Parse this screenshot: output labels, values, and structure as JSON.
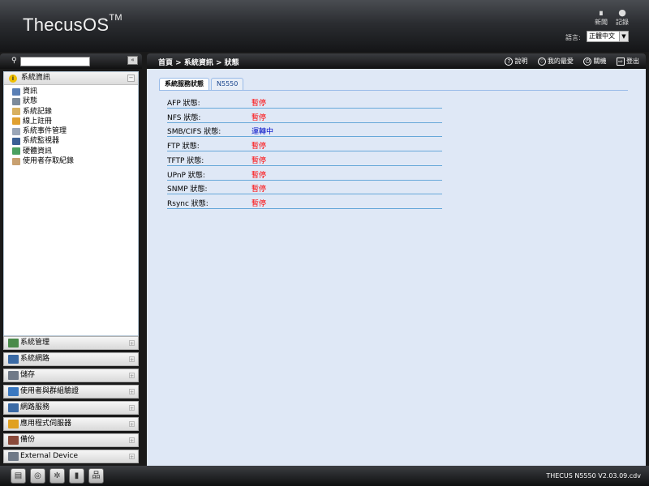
{
  "header": {
    "logo_text": "ThecusOS",
    "logo_tm": "TM",
    "news_label": "新聞",
    "log_label": "記錄",
    "language_label": "語言:",
    "language_value": "正體中文"
  },
  "sidebar": {
    "search_placeholder": "",
    "collapse_label": "«",
    "panel_title": "系統資訊",
    "items": [
      {
        "label": "資訊",
        "icon": "info-monitor-icon",
        "color": "#5a7fb5"
      },
      {
        "label": "狀態",
        "icon": "status-user-icon",
        "color": "#7c8a9a"
      },
      {
        "label": "系統記錄",
        "icon": "log-icon",
        "color": "#d8b060"
      },
      {
        "label": "線上註冊",
        "icon": "register-icon",
        "color": "#e0a030"
      },
      {
        "label": "系統事件管理",
        "icon": "event-icon",
        "color": "#9aa6b8"
      },
      {
        "label": "系統監視器",
        "icon": "monitor-icon",
        "color": "#3a5f95"
      },
      {
        "label": "硬體資訊",
        "icon": "hardware-icon",
        "color": "#4aa060"
      },
      {
        "label": "使用者存取紀錄",
        "icon": "access-log-icon",
        "color": "#c8a070"
      }
    ],
    "sections": [
      {
        "label": "系統管理",
        "icon": "tools-icon",
        "color": "#4a8a4a"
      },
      {
        "label": "系統網路",
        "icon": "network-icon",
        "color": "#3a6aa5"
      },
      {
        "label": "儲存",
        "icon": "storage-icon",
        "color": "#707a88"
      },
      {
        "label": "使用者與群組驗證",
        "icon": "users-icon",
        "color": "#3a78c0"
      },
      {
        "label": "網路服務",
        "icon": "network-service-icon",
        "color": "#3a6aa5"
      },
      {
        "label": "應用程式伺服器",
        "icon": "app-server-icon",
        "color": "#e0a020"
      },
      {
        "label": "備份",
        "icon": "backup-icon",
        "color": "#8a4a3a"
      },
      {
        "label": "External Device",
        "icon": "external-device-icon",
        "color": "#707a88"
      }
    ]
  },
  "main": {
    "breadcrumb": {
      "home": "首頁",
      "sep1": " > ",
      "level1": "系統資訊",
      "sep2": " > ",
      "level2": "狀態"
    },
    "toolbar": {
      "help": "說明",
      "favorites": "我的最愛",
      "shutdown": "關機",
      "logout": "登出"
    },
    "tabs": [
      {
        "label": "系統服務狀態",
        "active": true
      },
      {
        "label": "N5550",
        "active": false
      }
    ],
    "services": [
      {
        "label": "AFP 狀態:",
        "value": "暫停",
        "status": "stop"
      },
      {
        "label": "NFS 狀態:",
        "value": "暫停",
        "status": "stop"
      },
      {
        "label": "SMB/CIFS 狀態:",
        "value": "運轉中",
        "status": "run"
      },
      {
        "label": "FTP 狀態:",
        "value": "暫停",
        "status": "stop"
      },
      {
        "label": "TFTP 狀態:",
        "value": "暫停",
        "status": "stop"
      },
      {
        "label": "UPnP 狀態:",
        "value": "暫停",
        "status": "stop"
      },
      {
        "label": "SNMP 狀態:",
        "value": "暫停",
        "status": "stop"
      },
      {
        "label": "Rsync 狀態:",
        "value": "暫停",
        "status": "stop"
      }
    ]
  },
  "footer": {
    "version": "THECUS N5550 V2.03.09.cdv",
    "buttons": [
      "disk-icon",
      "cd-icon",
      "fan-icon",
      "thermometer-icon",
      "network-tree-icon"
    ]
  }
}
